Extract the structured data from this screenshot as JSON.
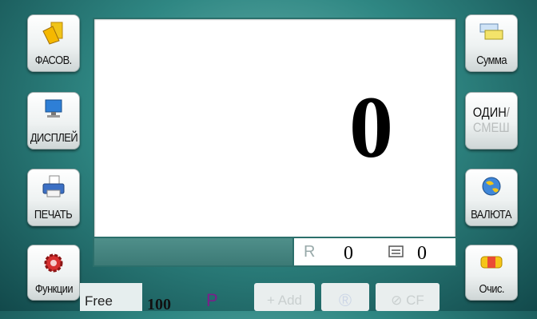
{
  "left_buttons": {
    "fasov": {
      "label": "ФАСОВ.",
      "icon": "folder-icon"
    },
    "display": {
      "label": "ДИСПЛЕЙ",
      "icon": "monitor-icon"
    },
    "print": {
      "label": "ПЕЧАТЬ",
      "icon": "printer-icon"
    },
    "functions": {
      "label": "Функции",
      "icon": "gear-icon"
    }
  },
  "right_buttons": {
    "summa": {
      "label": "Сумма",
      "icon": "banknote-icon"
    },
    "mode": {
      "top": "ОДИН",
      "slash": "/",
      "bottom": "СМЕШ"
    },
    "currency": {
      "label": "ВАЛЮТА",
      "icon": "globe-icon"
    },
    "clear": {
      "label": "Очис.",
      "icon": "eraser-icon"
    }
  },
  "display": {
    "count": "0",
    "reject_symbol": "R",
    "reject_count": "0",
    "batch_count": "0"
  },
  "bottom_bar": {
    "free_label": "Free",
    "free_value": "100",
    "p_label": "P",
    "add_label": "+ Add",
    "r_label": "®",
    "cf_label": "⊘ CF"
  },
  "colors": {
    "background": "#2f8783",
    "display_border": "#2b6f6b",
    "p_label": "#7a1f8a"
  }
}
